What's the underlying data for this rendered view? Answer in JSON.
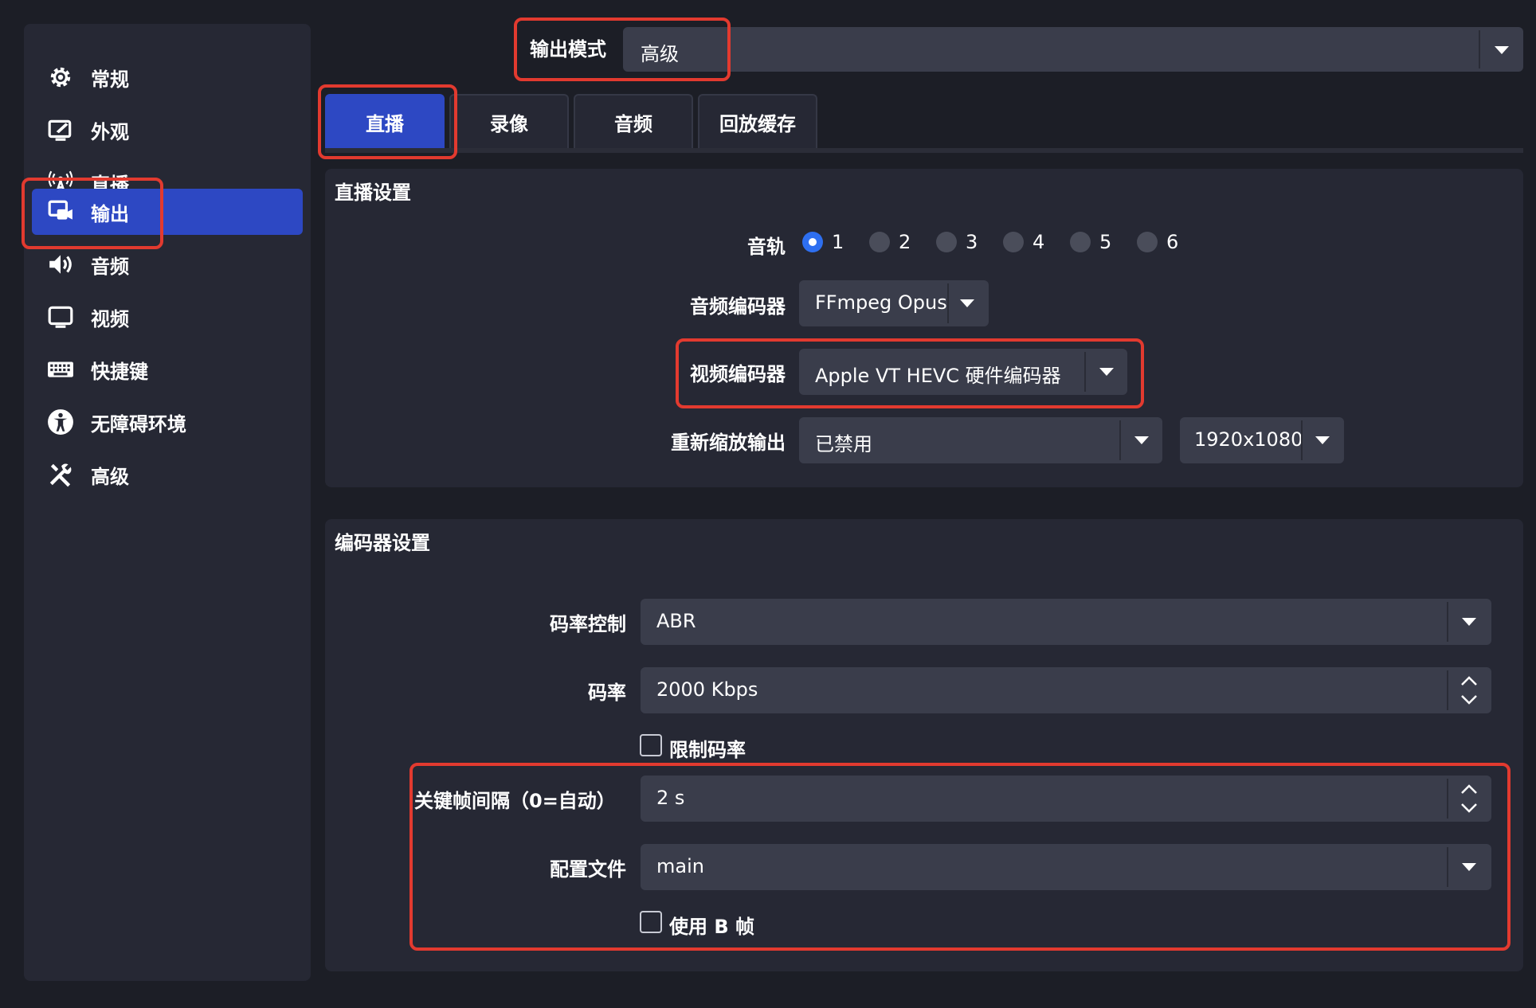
{
  "sidebar": {
    "items": [
      {
        "label": "常规",
        "icon": "gear-icon"
      },
      {
        "label": "外观",
        "icon": "appearance-icon"
      },
      {
        "label": "直播",
        "icon": "antenna-icon"
      },
      {
        "label": "输出",
        "icon": "output-icon",
        "active": true
      },
      {
        "label": "音频",
        "icon": "speaker-icon"
      },
      {
        "label": "视频",
        "icon": "monitor-icon"
      },
      {
        "label": "快捷键",
        "icon": "keyboard-icon"
      },
      {
        "label": "无障碍环境",
        "icon": "accessibility-icon"
      },
      {
        "label": "高级",
        "icon": "tools-icon"
      }
    ]
  },
  "output_mode": {
    "label": "输出模式",
    "value": "高级"
  },
  "tabs": [
    {
      "label": "直播",
      "active": true
    },
    {
      "label": "录像"
    },
    {
      "label": "音频"
    },
    {
      "label": "回放缓存"
    }
  ],
  "stream_settings": {
    "title": "直播设置",
    "audio_track": {
      "label": "音轨",
      "options": [
        "1",
        "2",
        "3",
        "4",
        "5",
        "6"
      ],
      "selected": "1"
    },
    "audio_encoder": {
      "label": "音频编码器",
      "value": "FFmpeg Opus"
    },
    "video_encoder": {
      "label": "视频编码器",
      "value": "Apple VT HEVC 硬件编码器"
    },
    "rescale": {
      "label": "重新缩放输出",
      "value": "已禁用",
      "resolution": "1920x1080"
    }
  },
  "encoder_settings": {
    "title": "编码器设置",
    "rate_control": {
      "label": "码率控制",
      "value": "ABR"
    },
    "bitrate": {
      "label": "码率",
      "value": "2000 Kbps"
    },
    "limit_bitrate": {
      "label": "限制码率",
      "checked": false
    },
    "keyframe": {
      "label": "关键帧间隔（0=自动）",
      "value": "2 s"
    },
    "profile": {
      "label": "配置文件",
      "value": "main"
    },
    "bframes": {
      "label": "使用 B 帧",
      "checked": false
    }
  },
  "colors": {
    "accent": "#2d48c3",
    "annotation": "#e23a2f",
    "radio_checked": "#2e6ff0"
  }
}
